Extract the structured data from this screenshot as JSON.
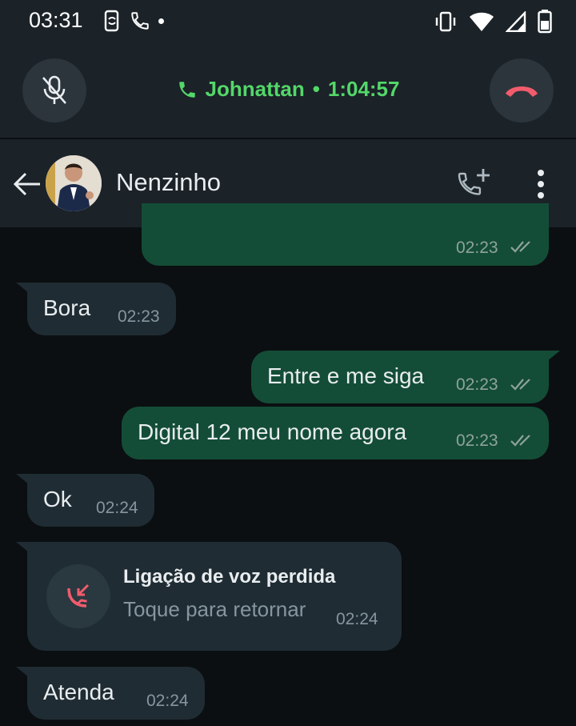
{
  "status_bar": {
    "time": "03:31"
  },
  "call": {
    "contact": "Johnattan",
    "separator": "•",
    "duration": "1:04:57"
  },
  "chat": {
    "contact_name": "Nenzinho"
  },
  "messages": [
    {
      "direction": "out",
      "text": "",
      "time": "02:23",
      "status": "read"
    },
    {
      "direction": "in",
      "text": "Bora",
      "time": "02:23"
    },
    {
      "direction": "out",
      "text": "Entre e me siga",
      "time": "02:23",
      "status": "read"
    },
    {
      "direction": "out",
      "text": "Digital 12 meu nome agora",
      "time": "02:23",
      "status": "read"
    },
    {
      "direction": "in",
      "text": "Ok",
      "time": "02:24"
    },
    {
      "direction": "in",
      "type": "missed-call",
      "title": "Ligação de voz perdida",
      "subtitle": "Toque para retornar",
      "time": "02:24"
    },
    {
      "direction": "in",
      "text": "Atenda",
      "time": "02:24"
    }
  ],
  "colors": {
    "call_green": "#53d769",
    "outgoing_bubble": "#144d37",
    "incoming_bubble": "#1f2c33",
    "hangup_red": "#f15c6d",
    "read_ticks": "#8fa39b"
  }
}
